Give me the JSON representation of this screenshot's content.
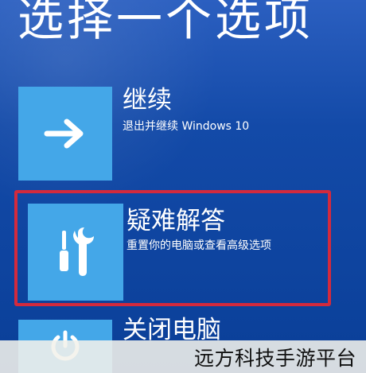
{
  "screen": {
    "title": "选择一个选项"
  },
  "options": [
    {
      "label": "继续",
      "description": "退出并继续 Windows 10",
      "icon": "arrow-right-icon"
    },
    {
      "label": "疑难解答",
      "description": "重置你的电脑或查看高级选项",
      "icon": "troubleshoot-tools-icon"
    },
    {
      "label": "关闭电脑",
      "icon": "power-icon"
    }
  ],
  "watermark": {
    "text": "远方科技手游平台"
  },
  "colors": {
    "background": "#134aa8",
    "tile": "#44a7e8",
    "highlight": "#d32a3d",
    "text": "#ffffff",
    "watermark_bar": "#f3f1eb"
  }
}
